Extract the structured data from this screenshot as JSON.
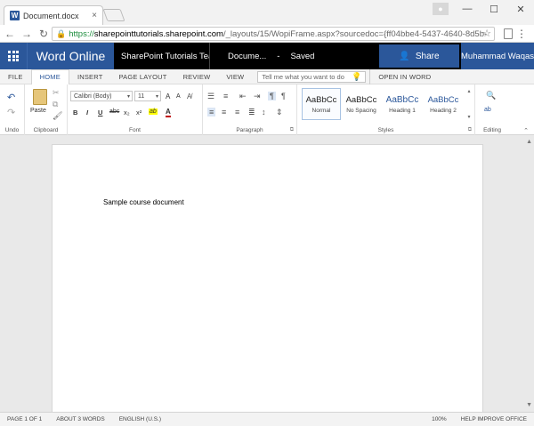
{
  "browser": {
    "tab_title": "Document.docx",
    "tab_icon": "W",
    "tab_close": "×",
    "url_https": "https://",
    "url_host": "sharepointtutorials.sharepoint.com",
    "url_path": "/_layouts/15/WopiFrame.aspx?sourcedoc={ff04bbe4-5437-4640-8d5b-",
    "window_controls": [
      "—",
      "☐",
      "✕"
    ],
    "back": "←",
    "forward": "→",
    "reload": "↻",
    "star": "☆",
    "menu": "⋮"
  },
  "office": {
    "app_name": "Word Online",
    "site_name": "SharePoint Tutorials Team ...",
    "doc_name": "Docume...",
    "separator": "-",
    "save_status": "Saved",
    "share_label": "Share",
    "user_name": "Muhammad Waqas"
  },
  "ribbon_tabs": [
    "FILE",
    "HOME",
    "INSERT",
    "PAGE LAYOUT",
    "REVIEW",
    "VIEW"
  ],
  "tell_me_placeholder": "Tell me what you want to do",
  "open_in_word": "OPEN IN WORD",
  "groups": {
    "undo": "Undo",
    "clipboard": "Clipboard",
    "font": "Font",
    "paragraph": "Paragraph",
    "styles": "Styles",
    "editing": "Editing"
  },
  "clipboard": {
    "paste": "Paste"
  },
  "font": {
    "family": "Calibri (Body)",
    "size": "11",
    "grow": "A",
    "shrink": "A",
    "bold": "B",
    "italic": "I",
    "underline": "U",
    "strike": "abc",
    "subscript": "x₂",
    "superscript": "x²",
    "highlight": "ab",
    "color": "A"
  },
  "styles": [
    {
      "sample": "AaBbCc",
      "name": "Normal"
    },
    {
      "sample": "AaBbCc",
      "name": "No Spacing"
    },
    {
      "sample": "AaBbCc",
      "name": "Heading 1"
    },
    {
      "sample": "AaBbCc",
      "name": "Heading 2"
    }
  ],
  "document": {
    "text": "Sample course document"
  },
  "status": {
    "page": "PAGE 1 OF 1",
    "words": "ABOUT 3 WORDS",
    "language": "ENGLISH (U.S.)",
    "zoom": "100%",
    "help": "HELP IMPROVE OFFICE"
  },
  "colors": {
    "word_blue": "#2b579a",
    "office_bar": "#000000",
    "highlight_yellow": "#ffff00",
    "font_red": "#c00000",
    "bulb": "#f0a30a"
  }
}
